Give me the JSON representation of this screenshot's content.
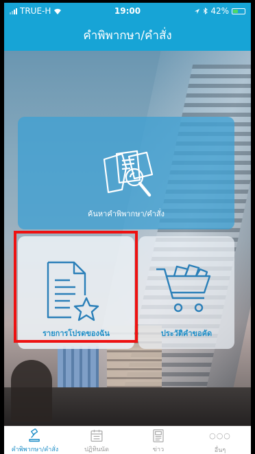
{
  "status_bar": {
    "carrier": "TRUE-H",
    "time": "19:00",
    "battery": "42%",
    "battery_level": 0.42,
    "icons": [
      "signal-icon",
      "wifi-icon",
      "location-arrow-icon",
      "bluetooth-icon",
      "battery-icon"
    ]
  },
  "header": {
    "title": "คำพิพากษา/คำสั่ง"
  },
  "tiles": {
    "search": {
      "label": "ค้นหาคำพิพากษา/คำสั่ง",
      "icon": "document-search-icon"
    },
    "favorites": {
      "label": "รายการโปรดของฉัน",
      "icon": "document-star-icon"
    },
    "order_history": {
      "label": "ประวัติคำขอคัด",
      "icon": "shopping-cart-icon"
    }
  },
  "tab_bar": {
    "items": [
      {
        "label": "คำพิพากษา/คำสั่ง",
        "icon": "gavel-icon",
        "active": true
      },
      {
        "label": "ปฏิทินนัด",
        "icon": "calendar-icon",
        "active": false
      },
      {
        "label": "ข่าว",
        "icon": "newspaper-icon",
        "active": false
      },
      {
        "label": "อื่นๆ",
        "icon": "more-icon",
        "active": false
      }
    ]
  },
  "colors": {
    "accent": "#17a4d6",
    "tile_label": "#1e8ec7",
    "highlight": "#ee1111"
  }
}
